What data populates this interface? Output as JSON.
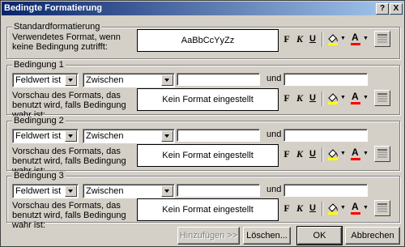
{
  "window": {
    "title": "Bedingte Formatierung",
    "help_glyph": "?",
    "close_glyph": "X"
  },
  "standard": {
    "group_label": "Standardformatierung",
    "label": "Verwendetes Format, wenn keine Bedingung zutrifft:",
    "preview": "AaBbCcYyZz"
  },
  "format_buttons": {
    "bold": "F",
    "italic": "K",
    "underline": "U",
    "font_color_glyph": "A"
  },
  "conditions": [
    {
      "group_label": "Bedingung 1",
      "type": "Feldwert ist",
      "operator": "Zwischen",
      "and_label": "und",
      "label": "Vorschau des Formats, das benutzt wird, falls Bedingung wahr ist:",
      "preview": "Kein Format eingestellt"
    },
    {
      "group_label": "Bedingung 2",
      "type": "Feldwert ist",
      "operator": "Zwischen",
      "and_label": "und",
      "label": "Vorschau des Formats, das benutzt wird, falls Bedingung wahr ist:",
      "preview": "Kein Format eingestellt"
    },
    {
      "group_label": "Bedingung 3",
      "type": "Feldwert ist",
      "operator": "Zwischen",
      "and_label": "und",
      "label": "Vorschau des Formats, das benutzt wird, falls Bedingung wahr ist:",
      "preview": "Kein Format eingestellt"
    }
  ],
  "buttons": {
    "add": "Hinzufügen >>",
    "delete": "Löschen...",
    "ok": "OK",
    "cancel": "Abbrechen"
  },
  "colors": {
    "titlebar_start": "#0a246a",
    "titlebar_end": "#a6caf0",
    "font_color_bar": "#ff0000",
    "fill_color_bar": "#ffff00"
  }
}
